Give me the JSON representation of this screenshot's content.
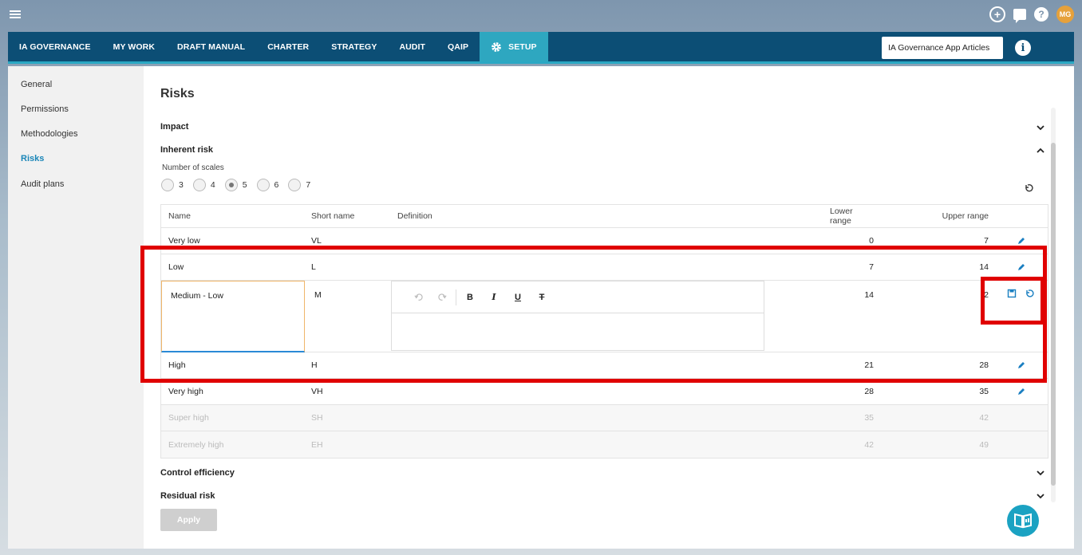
{
  "topbar": {
    "avatar_initials": "MG"
  },
  "nav": {
    "items": [
      "IA GOVERNANCE",
      "MY WORK",
      "DRAFT MANUAL",
      "CHARTER",
      "STRATEGY",
      "AUDIT",
      "QAIP"
    ],
    "active": "SETUP",
    "search_value": "IA Governance App Articles"
  },
  "sidebar": {
    "items": [
      "General",
      "Permissions",
      "Methodologies",
      "Risks",
      "Audit plans"
    ],
    "active_index": 3
  },
  "page": {
    "title": "Risks",
    "sections": {
      "impact": "Impact",
      "inherent": "Inherent risk",
      "control": "Control efficiency",
      "residual": "Residual risk"
    },
    "scales_label": "Number of scales",
    "scales": [
      "3",
      "4",
      "5",
      "6",
      "7"
    ],
    "selected_scale": "5",
    "apply_label": "Apply"
  },
  "table": {
    "headers": {
      "name": "Name",
      "short": "Short name",
      "definition": "Definition",
      "lower": "Lower range",
      "upper": "Upper range"
    },
    "rows": [
      {
        "name": "Very low",
        "short": "VL",
        "lower": "0",
        "upper": "7"
      },
      {
        "name": "Low",
        "short": "L",
        "lower": "7",
        "upper": "14"
      },
      {
        "name": "Medium - Low",
        "short": "M",
        "lower": "14",
        "upper": "2"
      },
      {
        "name": "High",
        "short": "H",
        "lower": "21",
        "upper": "28"
      },
      {
        "name": "Very high",
        "short": "VH",
        "lower": "28",
        "upper": "35"
      },
      {
        "name": "Super high",
        "short": "SH",
        "lower": "35",
        "upper": "42"
      },
      {
        "name": "Extremely high",
        "short": "EH",
        "lower": "42",
        "upper": "49"
      }
    ]
  },
  "editor_toolbar": {
    "bold": "B",
    "italic": "I",
    "underline": "U",
    "strike": "T"
  },
  "colors": {
    "nav_bg": "#0c4e75",
    "accent": "#2ea7c0",
    "link": "#1a86b8",
    "highlight": "#e00000"
  }
}
